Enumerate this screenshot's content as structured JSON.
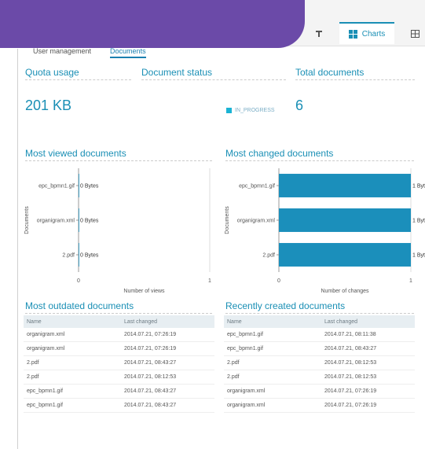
{
  "toolbar": {
    "charts_label": "Charts"
  },
  "tabs": [
    {
      "label": "User management",
      "active": false
    },
    {
      "label": "Documents",
      "active": true
    }
  ],
  "sections": {
    "quota": {
      "title": "Quota usage",
      "value": "201 KB"
    },
    "status": {
      "title": "Document status",
      "legend": "IN_PROGRESS"
    },
    "total": {
      "title": "Total documents",
      "value": "6"
    }
  },
  "colors": {
    "accent": "#1a8fb5",
    "bar": "#1b8fbb",
    "purple": "#6b4aa8"
  },
  "chart_data": [
    {
      "type": "bar",
      "orientation": "horizontal",
      "title": "Most viewed documents",
      "categories": [
        "epc_bpmn1.gif",
        "organigram.xml",
        "2.pdf"
      ],
      "values": [
        0,
        0,
        0
      ],
      "data_labels": [
        "0 Bytes",
        "0 Bytes",
        "0 Bytes"
      ],
      "xlabel": "Number of views",
      "ylabel": "Documents",
      "xlim": [
        0,
        1
      ],
      "xticks": [
        "0",
        "1"
      ]
    },
    {
      "type": "bar",
      "orientation": "horizontal",
      "title": "Most changed documents",
      "categories": [
        "epc_bpmn1.gif",
        "organigram.xml",
        "2.pdf"
      ],
      "values": [
        1,
        1,
        1
      ],
      "data_labels": [
        "1 Byt",
        "1 Byt",
        "1 Byt"
      ],
      "xlabel": "Number of changes",
      "ylabel": "Documents",
      "xlim": [
        0,
        1
      ],
      "xticks": [
        "0",
        "1"
      ]
    }
  ],
  "tables": {
    "outdated": {
      "title": "Most outdated documents",
      "headers": [
        "Name",
        "Last changed"
      ],
      "rows": [
        [
          "organigram.xml",
          "2014.07.21, 07:26:19"
        ],
        [
          "organigram.xml",
          "2014.07.21, 07:26:19"
        ],
        [
          "2.pdf",
          "2014.07.21, 08:43:27"
        ],
        [
          "2.pdf",
          "2014.07.21, 08:12:53"
        ],
        [
          "epc_bpmn1.gif",
          "2014.07.21, 08:43:27"
        ],
        [
          "epc_bpmn1.gif",
          "2014.07.21, 08:43:27"
        ]
      ]
    },
    "recent": {
      "title": "Recently created documents",
      "headers": [
        "Name",
        "Last changed"
      ],
      "rows": [
        [
          "epc_bpmn1.gif",
          "2014.07.21, 08:11:38"
        ],
        [
          "epc_bpmn1.gif",
          "2014.07.21, 08:43:27"
        ],
        [
          "2.pdf",
          "2014.07.21, 08:12:53"
        ],
        [
          "2.pdf",
          "2014.07.21, 08:12:53"
        ],
        [
          "organigram.xml",
          "2014.07.21, 07:26:19"
        ],
        [
          "organigram.xml",
          "2014.07.21, 07:26:19"
        ]
      ]
    }
  }
}
